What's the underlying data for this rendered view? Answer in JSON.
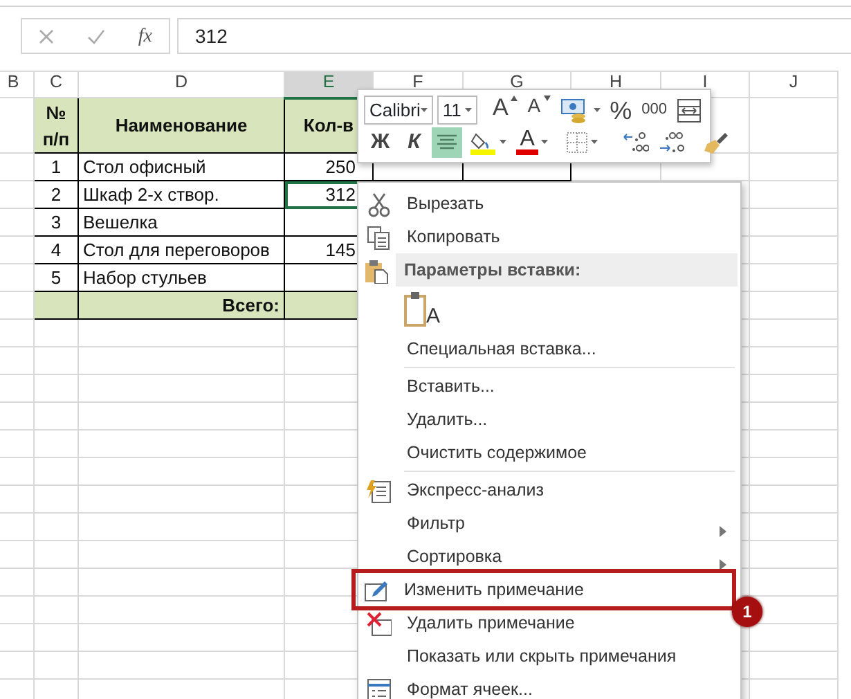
{
  "formula_bar": {
    "function_label": "fx",
    "value": "312"
  },
  "columns": [
    {
      "label": "B",
      "selected": false
    },
    {
      "label": "C",
      "selected": false
    },
    {
      "label": "D",
      "selected": false
    },
    {
      "label": "E",
      "selected": true
    },
    {
      "label": "F",
      "selected": false
    },
    {
      "label": "G",
      "selected": false
    },
    {
      "label": "H",
      "selected": false
    },
    {
      "label": "I",
      "selected": false
    },
    {
      "label": "J",
      "selected": false
    }
  ],
  "table": {
    "header": [
      "№ п/п",
      "Наименование",
      "Кол-в"
    ],
    "rows": [
      {
        "number": "1",
        "name": "Стол офисный",
        "quantity": "250",
        "selected": false
      },
      {
        "number": "2",
        "name": "Шкаф 2-х створ.",
        "quantity": "312",
        "selected": true
      },
      {
        "number": "3",
        "name": "Вешелка",
        "selected": false
      },
      {
        "number": "4",
        "name": "Стол для переговоров",
        "quantity": "145",
        "selected": false
      },
      {
        "number": "5",
        "name": "Набор стульев",
        "selected": false
      }
    ],
    "total_label": "Всего:"
  },
  "mini_toolbar": {
    "font": "Calibri",
    "size": "11",
    "row_1": [
      {
        "kind": "grow_font",
        "label": "A"
      },
      {
        "kind": "shrink_font",
        "label": "A"
      },
      {
        "kind": "accounting"
      },
      {
        "kind": "percent",
        "label": "%"
      },
      {
        "kind": "thousands",
        "label": "000"
      },
      {
        "kind": "wrap"
      }
    ],
    "row_2": [
      {
        "kind": "bold",
        "label": "Ж",
        "selected": false
      },
      {
        "kind": "italic",
        "label": "К",
        "selected": false
      },
      {
        "kind": "align_center",
        "selected": true
      },
      {
        "kind": "fill_color"
      },
      {
        "kind": "font_color",
        "label": "A"
      },
      {
        "kind": "borders"
      },
      {
        "kind": "increase_decimal"
      },
      {
        "kind": "decrease_decimal"
      },
      {
        "kind": "format_painter"
      }
    ]
  },
  "context_menu": {
    "items": [
      {
        "kind": "cut",
        "label": "Вырезать",
        "outlined": false
      },
      {
        "kind": "copy",
        "label": "Копировать",
        "outlined": false
      },
      {
        "kind": "header",
        "label": "Параметры вставки:",
        "outlined": false
      },
      {
        "kind": "paste_option",
        "label": "A"
      },
      {
        "kind": "plain",
        "label": "Специальная вставка...",
        "outlined": false
      },
      {
        "kind": "separator"
      },
      {
        "kind": "plain",
        "label": "Вставить...",
        "outlined": false
      },
      {
        "kind": "plain",
        "label": "Удалить...",
        "outlined": false
      },
      {
        "kind": "plain",
        "label": "Очистить содержимое",
        "outlined": false
      },
      {
        "kind": "separator"
      },
      {
        "kind": "quick_analysis",
        "label": "Экспресс-анализ",
        "outlined": false
      },
      {
        "kind": "submenu",
        "label": "Фильтр",
        "outlined": false
      },
      {
        "kind": "submenu",
        "label": "Сортировка",
        "outlined": false
      },
      {
        "kind": "edit_comment",
        "label": "Изменить примечание",
        "outlined": true
      },
      {
        "kind": "delete_comment",
        "label": "Удалить примечание",
        "outlined": false
      },
      {
        "kind": "plain",
        "label": "Показать или скрыть примечания",
        "outlined": false
      },
      {
        "kind": "format_cells",
        "label": "Формат ячеек...",
        "outlined": false
      }
    ]
  },
  "annotation": {
    "number": "1"
  }
}
